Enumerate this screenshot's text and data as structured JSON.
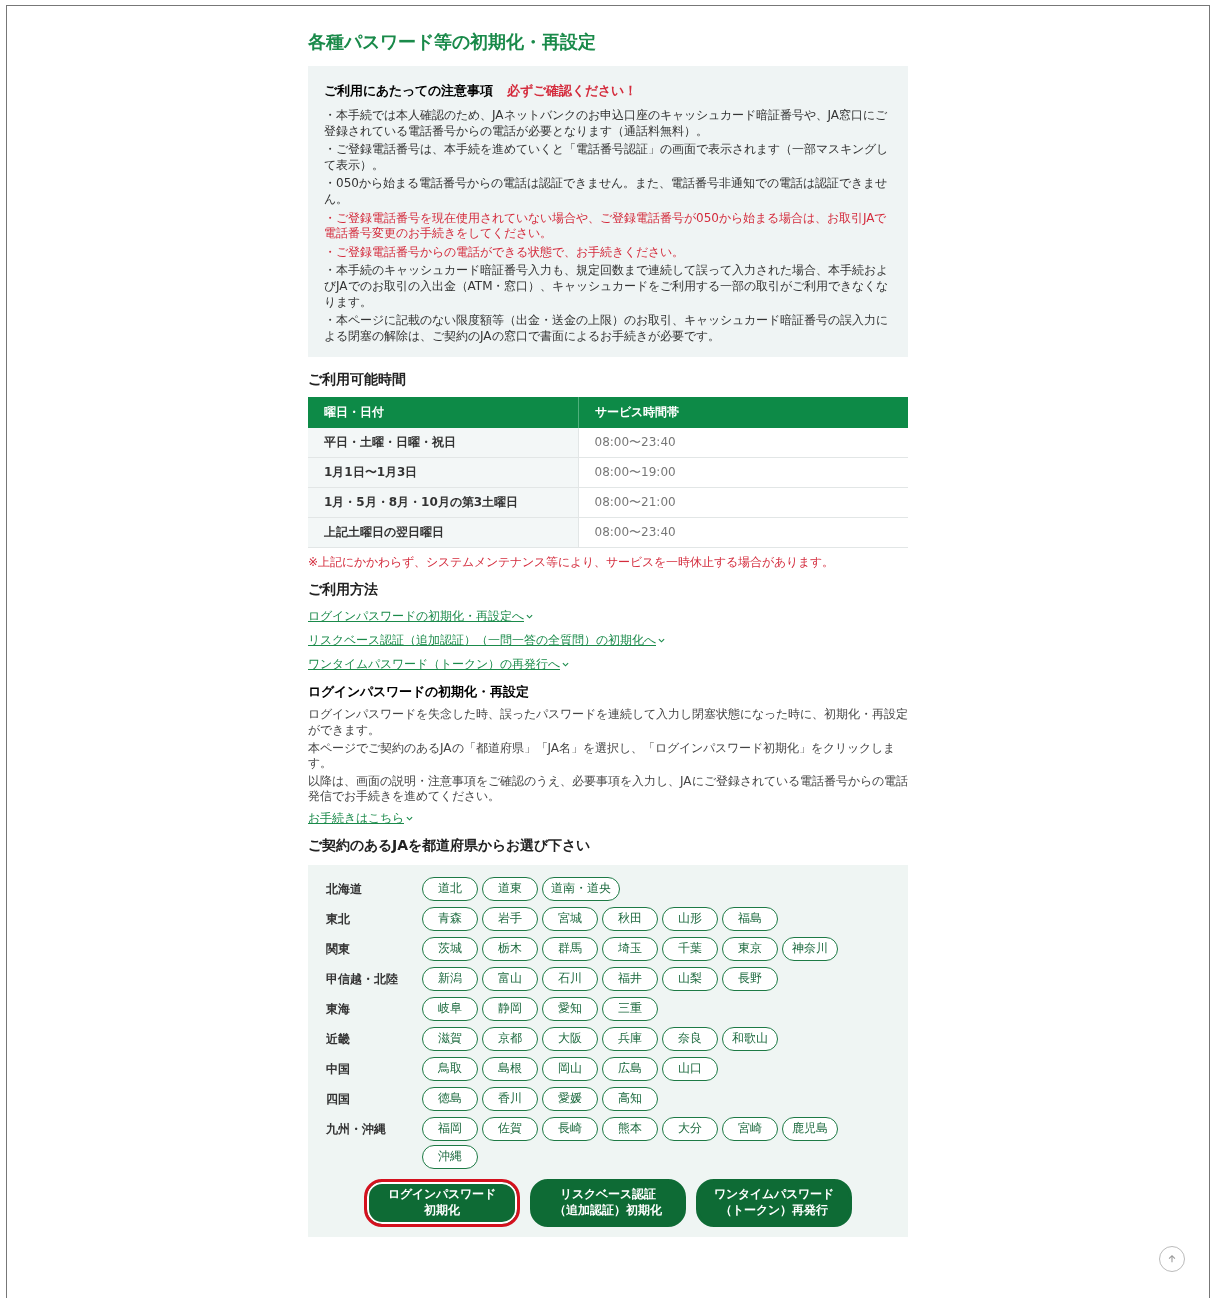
{
  "title": "各種パスワード等の初期化・再設定",
  "notice": {
    "heading": "ご利用にあたっての注意事項",
    "emphasis": "必ずご確認ください！",
    "items": [
      {
        "kind": "normal",
        "text": "・本手続では本人確認のため、JAネットバンクのお申込口座のキャッシュカード暗証番号や、JA窓口にご登録されている電話番号からの電話が必要となります（通話料無料）。"
      },
      {
        "kind": "normal",
        "text": "・ご登録電話番号は、本手続を進めていくと「電話番号認証」の画面で表示されます（一部マスキングして表示）。"
      },
      {
        "kind": "normal",
        "text": "・050から始まる電話番号からの電話は認証できません。また、電話番号非通知での電話は認証できません。"
      },
      {
        "kind": "warning",
        "text": "・ご登録電話番号を現在使用されていない場合や、ご登録電話番号が050から始まる場合は、お取引JAで電話番号変更のお手続きをしてください。"
      },
      {
        "kind": "warning",
        "text": "・ご登録電話番号からの電話ができる状態で、お手続きください。"
      },
      {
        "kind": "normal",
        "text": "・本手続のキャッシュカード暗証番号入力も、規定回数まで連続して誤って入力された場合、本手続およびJAでのお取引の入出金（ATM・窓口）、キャッシュカードをご利用する一部の取引がご利用できなくなります。"
      },
      {
        "kind": "normal",
        "text": "・本ページに記載のない限度額等（出金・送金の上限）のお取引、キャッシュカード暗証番号の誤入力による閉塞の解除は、ご契約のJAの窓口で書面によるお手続きが必要です。"
      }
    ]
  },
  "hours": {
    "heading": "ご利用可能時間",
    "columns": [
      "曜日・日付",
      "サービス時間帯"
    ],
    "rows": [
      [
        "平日・土曜・日曜・祝日",
        "08:00〜23:40"
      ],
      [
        "1月1日〜1月3日",
        "08:00〜19:00"
      ],
      [
        "1月・5月・8月・10月の第3土曜日",
        "08:00〜21:00"
      ],
      [
        "上記土曜日の翌日曜日",
        "08:00〜23:40"
      ]
    ],
    "footnote": "※上記にかかわらず、システムメンテナンス等により、サービスを一時休止する場合があります。"
  },
  "usage": {
    "heading": "ご利用方法",
    "links": [
      "ログインパスワードの初期化・再設定へ",
      "リスクベース認証（追加認証）（一問一答の全質問）の初期化へ",
      "ワンタイムパスワード（トークン）の再発行へ"
    ]
  },
  "login_reset": {
    "heading": "ログインパスワードの初期化・再設定",
    "paragraphs": [
      "ログインパスワードを失念した時、誤ったパスワードを連続して入力し閉塞状態になった時に、初期化・再設定ができます。",
      "本ページでご契約のあるJAの「都道府県」「JA名」を選択し、「ログインパスワード初期化」をクリックします。",
      "以降は、画面の説明・注意事項をご確認のうえ、必要事項を入力し、JAにご登録されている電話番号からの電話発信でお手続きを進めてください。"
    ],
    "link": "お手続きはこちら"
  },
  "prefecture_picker": {
    "heading": "ご契約のあるJAを都道府県からお選び下さい",
    "regions": [
      {
        "name": "北海道",
        "prefectures": [
          "道北",
          "道東",
          "道南・道央"
        ]
      },
      {
        "name": "東北",
        "prefectures": [
          "青森",
          "岩手",
          "宮城",
          "秋田",
          "山形",
          "福島"
        ]
      },
      {
        "name": "関東",
        "prefectures": [
          "茨城",
          "栃木",
          "群馬",
          "埼玉",
          "千葉",
          "東京",
          "神奈川"
        ]
      },
      {
        "name": "甲信越・北陸",
        "prefectures": [
          "新潟",
          "富山",
          "石川",
          "福井",
          "山梨",
          "長野"
        ]
      },
      {
        "name": "東海",
        "prefectures": [
          "岐阜",
          "静岡",
          "愛知",
          "三重"
        ]
      },
      {
        "name": "近畿",
        "prefectures": [
          "滋賀",
          "京都",
          "大阪",
          "兵庫",
          "奈良",
          "和歌山"
        ]
      },
      {
        "name": "中国",
        "prefectures": [
          "鳥取",
          "島根",
          "岡山",
          "広島",
          "山口"
        ]
      },
      {
        "name": "四国",
        "prefectures": [
          "徳島",
          "香川",
          "愛媛",
          "高知"
        ]
      },
      {
        "name": "九州・沖縄",
        "prefectures": [
          "福岡",
          "佐賀",
          "長崎",
          "熊本",
          "大分",
          "宮崎",
          "鹿児島",
          "沖縄"
        ]
      }
    ],
    "buttons": [
      {
        "lines": [
          "ログインパスワード",
          "初期化"
        ],
        "highlighted": true
      },
      {
        "lines": [
          "リスクベース認証",
          "（追加認証）初期化"
        ],
        "highlighted": false
      },
      {
        "lines": [
          "ワンタイムパスワード",
          "（トークン）再発行"
        ],
        "highlighted": false
      }
    ]
  }
}
